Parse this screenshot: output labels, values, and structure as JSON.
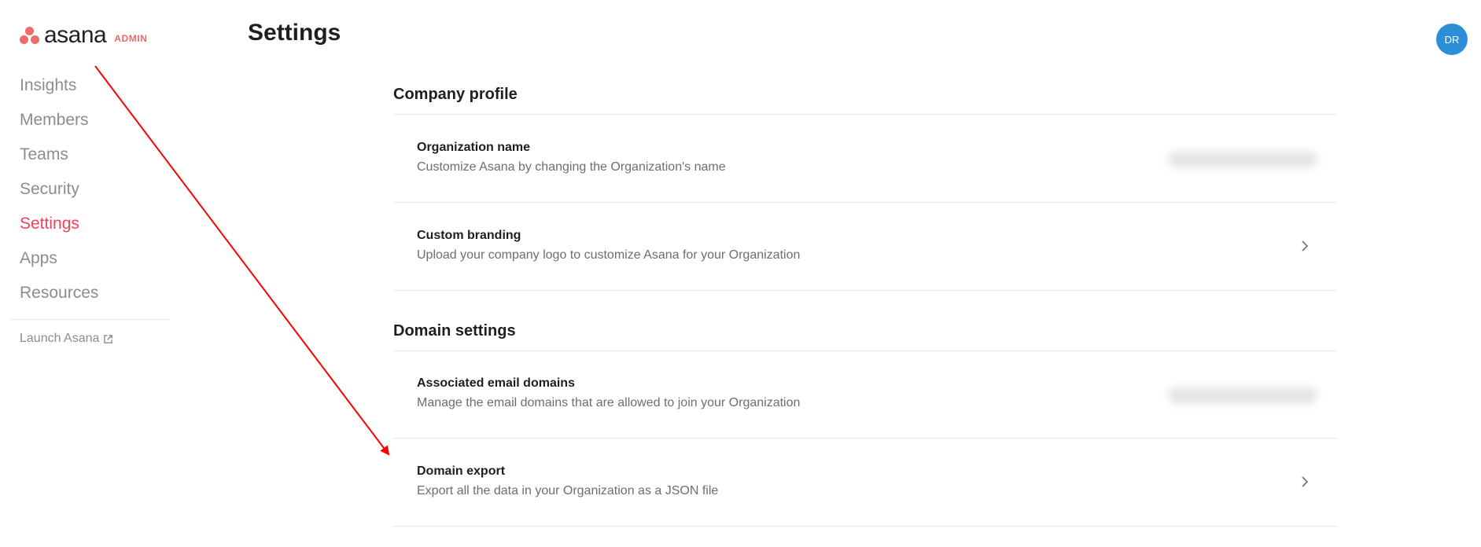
{
  "brand": {
    "wordmark": "asana",
    "badge": "ADMIN",
    "accent_color": "#f06a6a"
  },
  "sidebar": {
    "items": [
      {
        "label": "Insights",
        "active": false
      },
      {
        "label": "Members",
        "active": false
      },
      {
        "label": "Teams",
        "active": false
      },
      {
        "label": "Security",
        "active": false
      },
      {
        "label": "Settings",
        "active": true
      },
      {
        "label": "Apps",
        "active": false
      },
      {
        "label": "Resources",
        "active": false
      }
    ],
    "launch_label": "Launch Asana",
    "launch_icon": "external-link-icon"
  },
  "header": {
    "title": "Settings",
    "avatar_initials": "DR",
    "avatar_color": "#2d8ed8"
  },
  "sections": {
    "company_profile": {
      "title": "Company profile",
      "rows": [
        {
          "title": "Organization name",
          "description": "Customize Asana by changing the Organization's name",
          "value": "(blurred)"
        },
        {
          "title": "Custom branding",
          "description": "Upload your company logo to customize Asana for your Organization"
        }
      ]
    },
    "domain_settings": {
      "title": "Domain settings",
      "rows": [
        {
          "title": "Associated email domains",
          "description": "Manage the email domains that are allowed to join your Organization",
          "value": "(blurred)"
        },
        {
          "title": "Domain export",
          "description": "Export all the data in your Organization as a JSON file"
        }
      ]
    }
  },
  "annotation": {
    "type": "arrow",
    "color": "#ff0000",
    "points_to": "Domain export"
  }
}
